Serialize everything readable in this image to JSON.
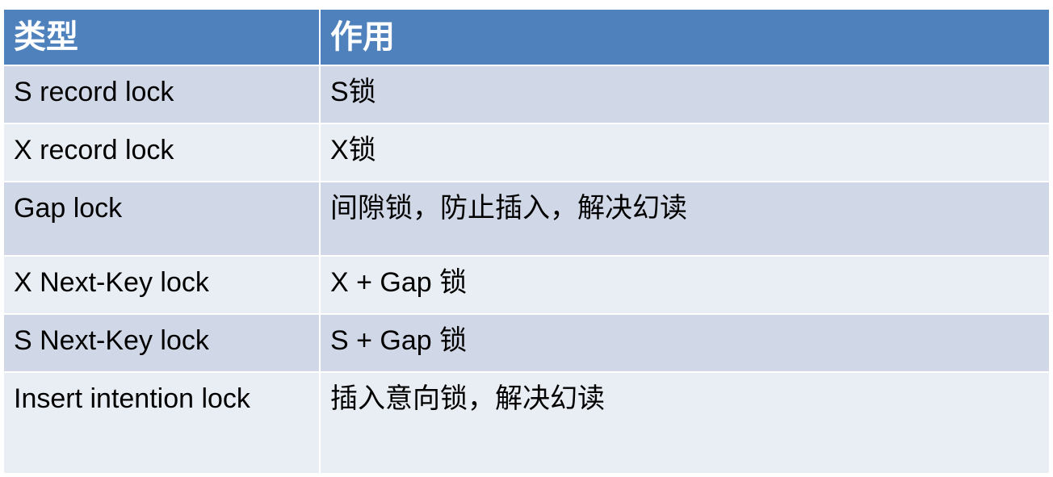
{
  "table": {
    "headers": {
      "type": "类型",
      "purpose": "作用"
    },
    "rows": [
      {
        "type": "S record lock",
        "purpose": "S锁"
      },
      {
        "type": "X record lock",
        "purpose": "X锁"
      },
      {
        "type": "Gap lock",
        "purpose": "间隙锁，防止插入，解决幻读"
      },
      {
        "type": "X Next-Key lock",
        "purpose": "X + Gap 锁"
      },
      {
        "type": "S Next-Key lock",
        "purpose": "S + Gap  锁"
      },
      {
        "type": "Insert intention lock",
        "purpose": "插入意向锁，解决幻读"
      }
    ]
  },
  "colors": {
    "header": "#4f81bd",
    "row_dark": "#d0d8e8",
    "row_light": "#e9edf4"
  }
}
